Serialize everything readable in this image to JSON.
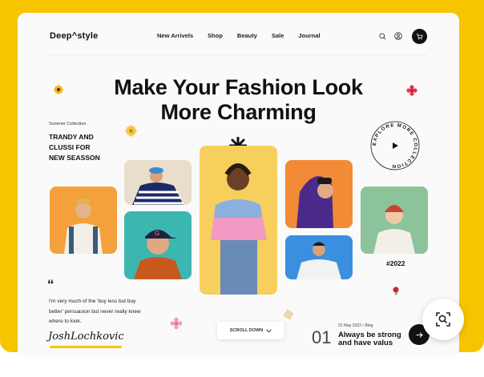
{
  "header": {
    "logo": "Deep^style",
    "nav": [
      "New Arrivels",
      "Shop",
      "Beauty",
      "Sale",
      "Journal"
    ]
  },
  "hero": {
    "line1": "Make Your Fashion Look",
    "line2": "More Charming"
  },
  "collection": {
    "eyebrow": "Summer Collection",
    "lines": [
      "TRANDY AND",
      "CLUSSI FOR",
      "NEW SEASSON"
    ]
  },
  "explore_badge": "EXPLORE MORE COLLECTION",
  "quote": {
    "mark": "“",
    "lines": [
      "I'm very much of the 'buy less but buy",
      "better' persuasion but never really knew",
      "where to look."
    ],
    "signature": "JoshLochkovic"
  },
  "scroll_label": "SCROLL DOWN",
  "blog": {
    "index": "01",
    "date": "31 May 2022  •  Blog",
    "title_line1": "Always be strong",
    "title_line2": "and have valus"
  },
  "tag_year": "#2022",
  "colors": {
    "frame_yellow": "#f6c500",
    "accent_black": "#111111",
    "tile_orange": "#f4a03c",
    "tile_teal": "#3bb7b0",
    "tile_yellow": "#f6cf5c",
    "tile_blue": "#3b8fe0",
    "tile_green": "#8cc39a"
  },
  "icons": [
    "search-icon",
    "user-icon",
    "cart-icon",
    "play-icon",
    "chevron-down-icon",
    "arrow-right-icon",
    "zoom-search-icon"
  ]
}
